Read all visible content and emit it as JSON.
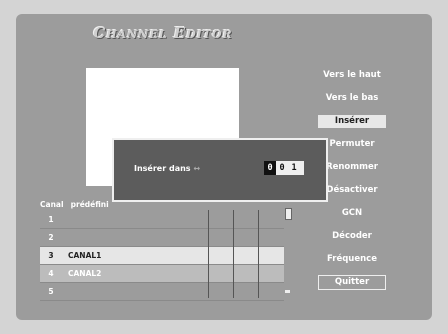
{
  "header": {
    "title": "Channel Editor"
  },
  "menu": {
    "items": [
      {
        "label": "Vers le haut"
      },
      {
        "label": "Vers le bas"
      },
      {
        "label": "Insérer",
        "selected": true
      },
      {
        "label": "Permuter"
      },
      {
        "label": "Renommer"
      },
      {
        "label": "Désactiver"
      },
      {
        "label": "GCN"
      },
      {
        "label": "Décoder"
      },
      {
        "label": "Fréquence"
      },
      {
        "label": "Quitter"
      }
    ]
  },
  "table": {
    "headers": [
      "Canal",
      "prédéfini"
    ],
    "rows": [
      {
        "num": "1",
        "name": ""
      },
      {
        "num": "2",
        "name": ""
      },
      {
        "num": "3",
        "name": "CANAL1"
      },
      {
        "num": "4",
        "name": "CANAL2"
      },
      {
        "num": "5",
        "name": ""
      }
    ]
  },
  "dialog": {
    "label": "Insérer dans",
    "arrows": "↔",
    "digits": [
      "0",
      "0",
      "1"
    ]
  }
}
